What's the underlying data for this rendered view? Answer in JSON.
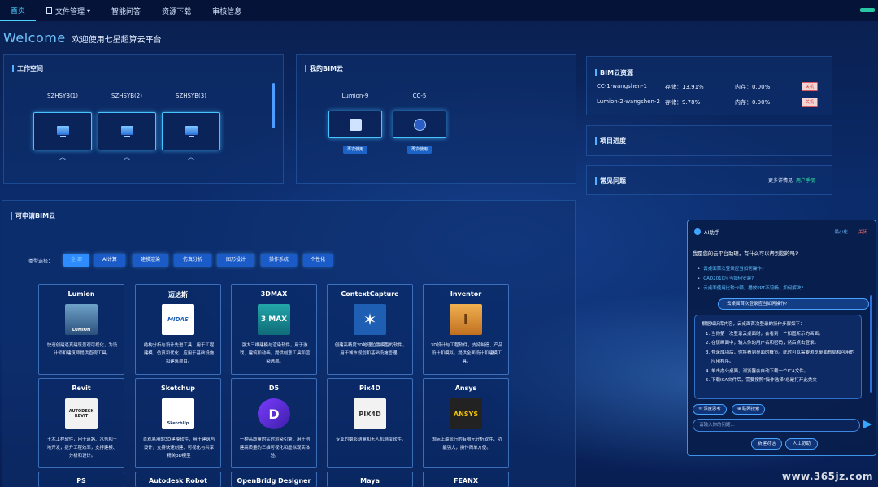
{
  "nav": {
    "items": [
      "首页",
      "文件管理",
      "智能问答",
      "资源下载",
      "审核信息"
    ],
    "file_caret": "▾"
  },
  "welcome": {
    "en": "Welcome",
    "cn": "欢迎使用七星超算云平台"
  },
  "workspace": {
    "title": "工作空间",
    "items": [
      "SZHSYB(1)",
      "SZHSYB(2)",
      "SZHSYB(3)"
    ],
    "chevron": "︽"
  },
  "my_bim": {
    "title": "我的BIM云",
    "items": [
      {
        "name": "Lumion-9",
        "btn": "再次使用"
      },
      {
        "name": "CC-5",
        "btn": "再次使用"
      }
    ]
  },
  "bim_resources": {
    "title": "BIM云资源",
    "rows": [
      {
        "name": "CC-1-wangshen-1",
        "storage": "存储：13.91%",
        "memory": "内存：0.00%",
        "btn": "关机"
      },
      {
        "name": "Lumion-2-wangshen-2",
        "storage": "存储：9.78%",
        "memory": "内存：0.00%",
        "btn": "关机"
      }
    ]
  },
  "project_progress": {
    "title": "项目进度"
  },
  "faq": {
    "title": "常见问题",
    "more": "更多详情见",
    "link": "用户手册"
  },
  "apply": {
    "title": "可申请BIM云",
    "type_label": "类型选择：",
    "types": [
      "全 部",
      "AI计算",
      "建模渲染",
      "仿真分析",
      "图形设计",
      "操作系统",
      "个性化"
    ]
  },
  "apps": [
    {
      "name": "Lumion",
      "logo": "LUMION",
      "desc": "快速创建逼真建筑景观可视化，为设计师和建筑师提供直观工具。"
    },
    {
      "name": "迈达斯",
      "logo": "MIDAS",
      "desc": "结构分析与设计先进工具，用于工程建模、仿真和优化，应用于基础设施和建筑项目。"
    },
    {
      "name": "3DMAX",
      "logo": "3 MAX",
      "desc": "强大三维建模与渲染软件，用于游戏、建筑和动画，提供创意工具和渲染选项。"
    },
    {
      "name": "ContextCapture",
      "logo": "✶",
      "desc": "创建高精度3D地理位置模型的软件，用于城市规划和基础设施管理。"
    },
    {
      "name": "Inventor",
      "logo": "I",
      "desc": "3D设计与工程软件，支持制造、产品设计和模拟，提供全面设计和建模工具。"
    },
    {
      "name": "Revit",
      "logo": "AUTODESK REVIT",
      "desc": "土木工程软件，用于道路、水务和土地开发，提升工程效率，支持建模、分析和设计。"
    },
    {
      "name": "Sketchup",
      "logo": "SketchUp",
      "desc": "直观易用的3D建模软件，用于建筑与设计，支持快速创建、可视化与共享精美3D模型"
    },
    {
      "name": "D5",
      "logo": "D",
      "desc": "一种高质量的实时渲染引擎，用于创建高质量的三维可视化和虚拟现实体验。"
    },
    {
      "name": "Pix4D",
      "logo": "PIX4D",
      "desc": "专业的摄影测量和无人机测绘软件。"
    },
    {
      "name": "Ansys",
      "logo": "ANSYS",
      "desc": "国际上最流行的有限元分析软件，功能强大，操作简单方便。"
    },
    {
      "name": "PS",
      "logo": "",
      "desc": ""
    },
    {
      "name": "Autodesk Robot",
      "logo": "",
      "desc": ""
    },
    {
      "name": "OpenBridg Designer",
      "logo": "",
      "desc": ""
    },
    {
      "name": "Maya",
      "logo": "",
      "desc": ""
    },
    {
      "name": "FEANX",
      "logo": "",
      "desc": ""
    }
  ],
  "chat": {
    "title": "AI助手",
    "minimize": "最小化",
    "close": "关闭",
    "greeting": "我是您的云平台助理，有什么可以帮到您的吗?",
    "suggestions": [
      "云桌面首次登录应当如何操作?",
      "CAD2010应当如何安装?",
      "云桌面使用比较卡顿，播放PPT不流畅，如何解决?"
    ],
    "user_msg": "云桌面首次登录应当如何操作?",
    "reply_intro": "根据知识库内容，云桌面首次登录的操作步骤如下：",
    "reply_steps": [
      "当你第一次登录云桌面时，会看到一个如图所示的画面。",
      "在该画面中，输入你的用户名和密码，然后点击登录。",
      "登录成功后，你将看到桌面的概览。此时可以需要浏览桌面布局和可用的应用程序。",
      "单击办公桌面，浏览器会自动下载一个ICA文件。",
      "下载ICA文件后，需要按照\"操作选择\"总是打开此类文"
    ],
    "chips": [
      "深度思考",
      "联网搜索"
    ],
    "input_placeholder": "请输入你的问题...",
    "actions": [
      "新建对话",
      "人工协助"
    ]
  },
  "watermark": "www.365jz.com"
}
